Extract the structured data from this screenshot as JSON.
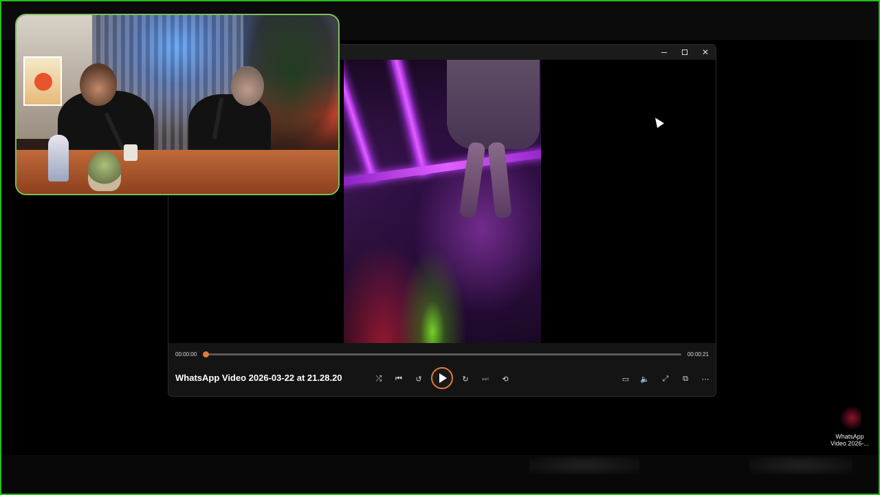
{
  "desktop": {
    "icon_label": "WhatsApp Video 2026-..."
  },
  "player": {
    "video_title": "WhatsApp Video 2026-03-22 at 21.28.20",
    "current_time": "00:00:00",
    "duration": "00:00:21",
    "progress_fraction": 0.0,
    "accent_color": "#e07a3a",
    "window_controls": {
      "minimize_icon": "minimize-icon",
      "maximize_icon": "maximize-icon",
      "close_icon": "close-icon"
    },
    "transport": [
      {
        "name": "shuffle-icon",
        "glyph": "⤮"
      },
      {
        "name": "previous-icon",
        "glyph": "⏮"
      },
      {
        "name": "rewind-10-icon",
        "glyph": "↺"
      },
      {
        "name": "forward-30-icon",
        "glyph": "↻"
      },
      {
        "name": "next-icon",
        "glyph": "⏭"
      },
      {
        "name": "repeat-off-icon",
        "glyph": "⟲"
      }
    ],
    "right_tools": [
      {
        "name": "captions-icon",
        "glyph": "▭"
      },
      {
        "name": "volume-icon",
        "glyph": "🔈"
      },
      {
        "name": "fullscreen-icon",
        "glyph": "⤢"
      },
      {
        "name": "miniplayer-icon",
        "glyph": "⧉"
      },
      {
        "name": "more-options-icon",
        "glyph": "⋯"
      }
    ]
  },
  "webcam": {
    "border_color": "#7cc05a"
  },
  "screen": {
    "border_color": "#22c01a"
  }
}
